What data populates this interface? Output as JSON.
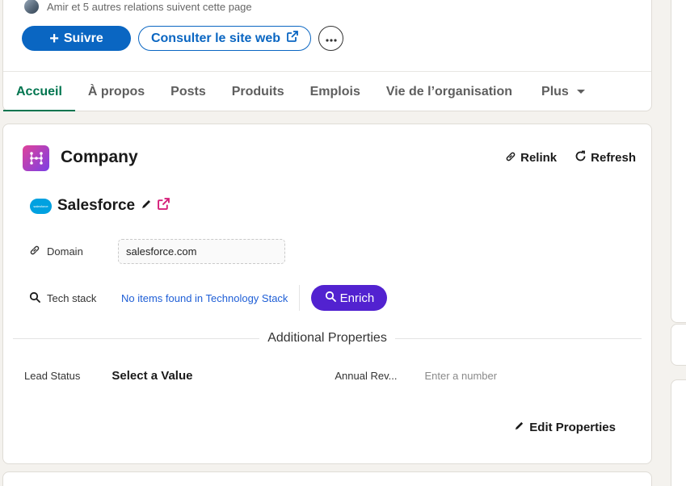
{
  "top_card": {
    "relations_text": "Amir et 5 autres relations suivent cette page",
    "follow_label": "Suivre",
    "site_label": "Consulter le site web",
    "tabs": [
      {
        "label": "Accueil",
        "active": true
      },
      {
        "label": "À propos",
        "active": false
      },
      {
        "label": "Posts",
        "active": false
      },
      {
        "label": "Produits",
        "active": false
      },
      {
        "label": "Emplois",
        "active": false
      },
      {
        "label": "Vie de l’organisation",
        "active": false
      },
      {
        "label": "Plus",
        "active": false
      }
    ]
  },
  "company_panel": {
    "title": "Company",
    "relink_label": "Relink",
    "refresh_label": "Refresh",
    "company_name": "Salesforce",
    "logo_text": "salesforce",
    "domain_label": "Domain",
    "domain_value": "salesforce.com",
    "tech_label": "Tech stack",
    "tech_empty": "No items found in Technology Stack",
    "enrich_label": "Enrich",
    "additional_title": "Additional Properties",
    "lead_status_label": "Lead Status",
    "lead_status_value": "Select a Value",
    "annual_rev_label": "Annual Rev...",
    "annual_rev_placeholder": "Enter a number",
    "edit_props_label": "Edit Properties"
  },
  "colors": {
    "linkedin_blue": "#0a66c2",
    "tab_active": "#01754f",
    "enrich_purple": "#5222d0",
    "salesforce_blue": "#00a1e0",
    "external_link_pink": "#d6207a"
  }
}
